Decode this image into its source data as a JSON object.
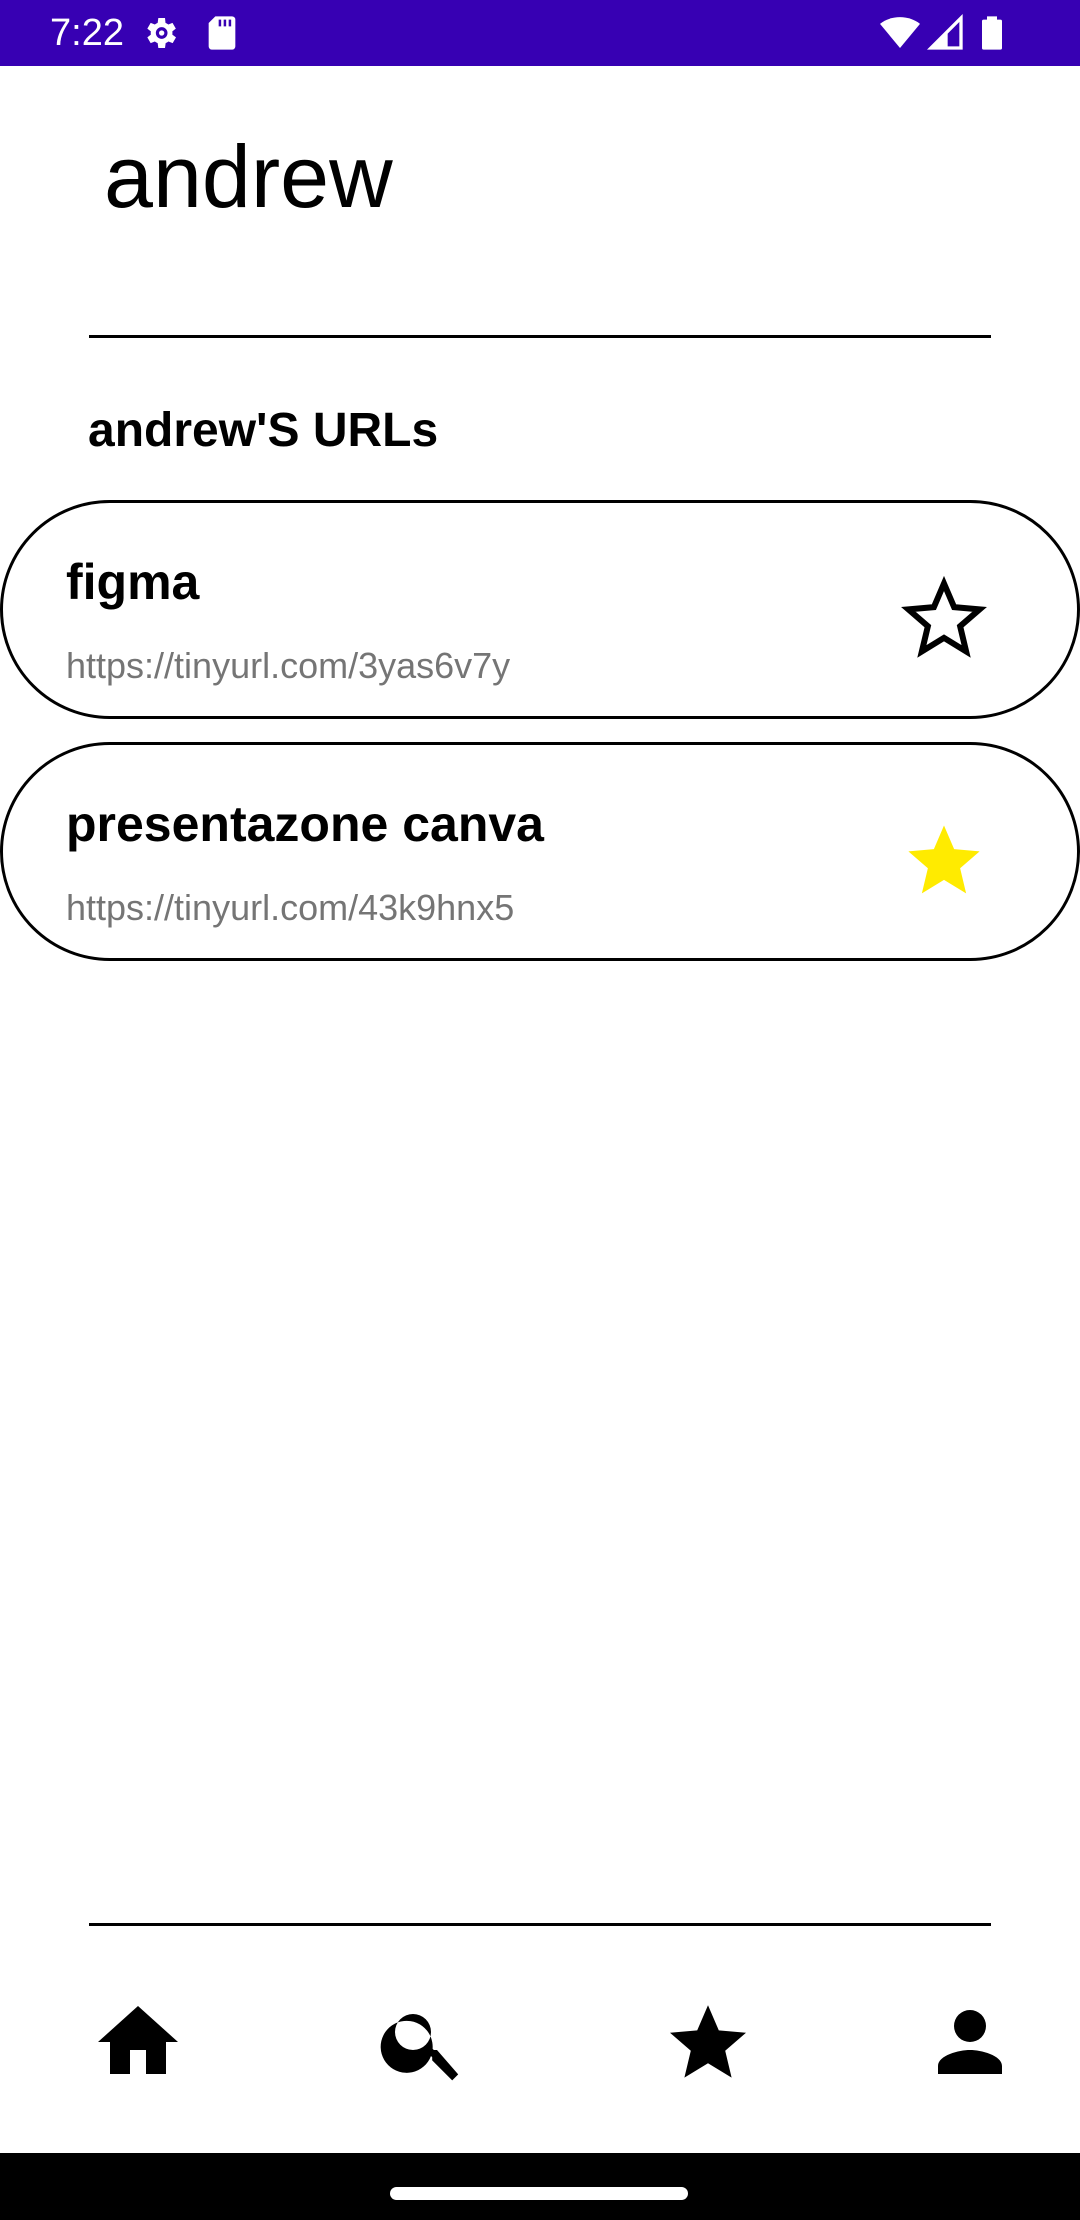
{
  "status_bar": {
    "time": "7:22",
    "background_color": "#3700b3",
    "left_icons": [
      "settings-gear-icon",
      "sd-card-icon"
    ],
    "right_icons": [
      "wifi-icon",
      "cell-signal-icon",
      "battery-icon"
    ]
  },
  "profile": {
    "name": "andrew"
  },
  "section": {
    "title": "andrew'S URLs"
  },
  "urls": [
    {
      "title": "figma",
      "link": "https://tinyurl.com/3yas6v7y",
      "favorite": false,
      "icon": "star-outline-icon"
    },
    {
      "title": "presentazone canva",
      "link": "https://tinyurl.com/43k9hnx5",
      "favorite": true,
      "icon": "star-filled-icon",
      "favorite_color": "#ffeb00"
    }
  ],
  "bottom_nav": {
    "items": [
      "home-icon",
      "search-icon",
      "favorites-star-icon",
      "profile-person-icon"
    ]
  }
}
